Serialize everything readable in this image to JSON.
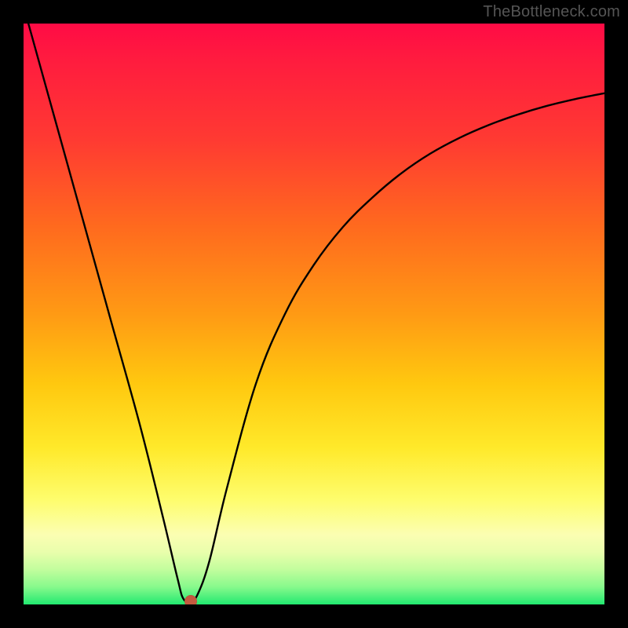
{
  "watermark": "TheBottleneck.com",
  "chart_data": {
    "type": "line",
    "title": "",
    "xlabel": "",
    "ylabel": "",
    "xlim": [
      0,
      100
    ],
    "ylim": [
      0,
      100
    ],
    "series": [
      {
        "name": "bottleneck-curve",
        "x": [
          0,
          5,
          10,
          15,
          20,
          24,
          26.5,
          27.5,
          28.8,
          30,
          32,
          35,
          40,
          45,
          50,
          55,
          60,
          65,
          70,
          75,
          80,
          85,
          90,
          95,
          100
        ],
        "values": [
          103,
          85,
          67,
          49,
          31,
          15,
          4.5,
          1.0,
          0.5,
          1.8,
          7.5,
          20,
          38,
          50,
          58.5,
          65,
          70,
          74.2,
          77.6,
          80.3,
          82.5,
          84.3,
          85.8,
          87,
          88
        ]
      }
    ],
    "marker": {
      "x": 28.8,
      "y": 0.5
    },
    "background_gradient": {
      "stops": [
        {
          "pos": 0.0,
          "color": "#ff0b45"
        },
        {
          "pos": 0.35,
          "color": "#ff6a1e"
        },
        {
          "pos": 0.62,
          "color": "#ffc80f"
        },
        {
          "pos": 0.82,
          "color": "#fefd6d"
        },
        {
          "pos": 1.0,
          "color": "#22e970"
        }
      ]
    }
  }
}
